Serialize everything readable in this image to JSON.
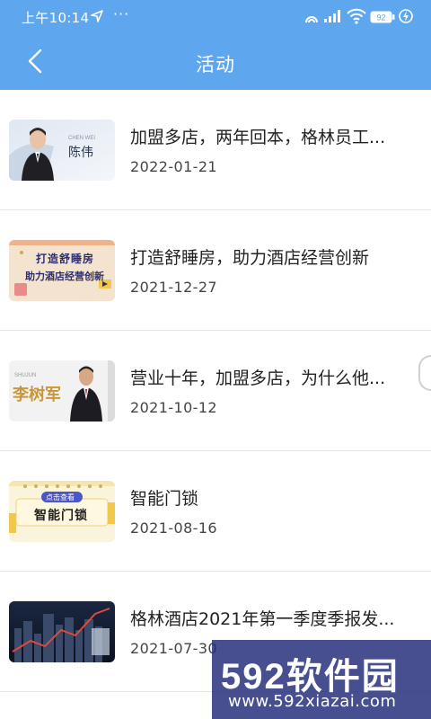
{
  "status_bar": {
    "time": "上午10:14",
    "dots": "···",
    "battery": "92",
    "icons": [
      "location-arrow-icon",
      "alarm-icon",
      "signal-icon",
      "wifi-icon",
      "battery-icon",
      "charging-icon"
    ]
  },
  "header": {
    "title": "活动",
    "back_icon": "chevron-left-icon",
    "color": "#5ea7ef"
  },
  "activities": [
    {
      "title": "加盟多店，两年回本，格林员工...",
      "date": "2022-01-21",
      "thumb": {
        "name_text": "陈伟",
        "caption": "CHEN WEI"
      }
    },
    {
      "title": "打造舒睡房，助力酒店经营创新",
      "date": "2021-12-27",
      "thumb": {
        "line1": "打造舒睡房",
        "line2": "助力酒店经营创新"
      }
    },
    {
      "title": "营业十年，加盟多店，为什么他...",
      "date": "2021-10-12",
      "thumb": {
        "name_text": "李树军",
        "caption": "SHUJUN"
      }
    },
    {
      "title": "智能门锁",
      "date": "2021-08-16",
      "thumb": {
        "tag": "点击查看",
        "main": "智能门锁"
      }
    },
    {
      "title": "格林酒店2021年第一季度季报发...",
      "date": "2021-07-30",
      "thumb": {}
    }
  ],
  "watermark": {
    "main": "592软件园",
    "sub": "www.592xiazai.com"
  }
}
